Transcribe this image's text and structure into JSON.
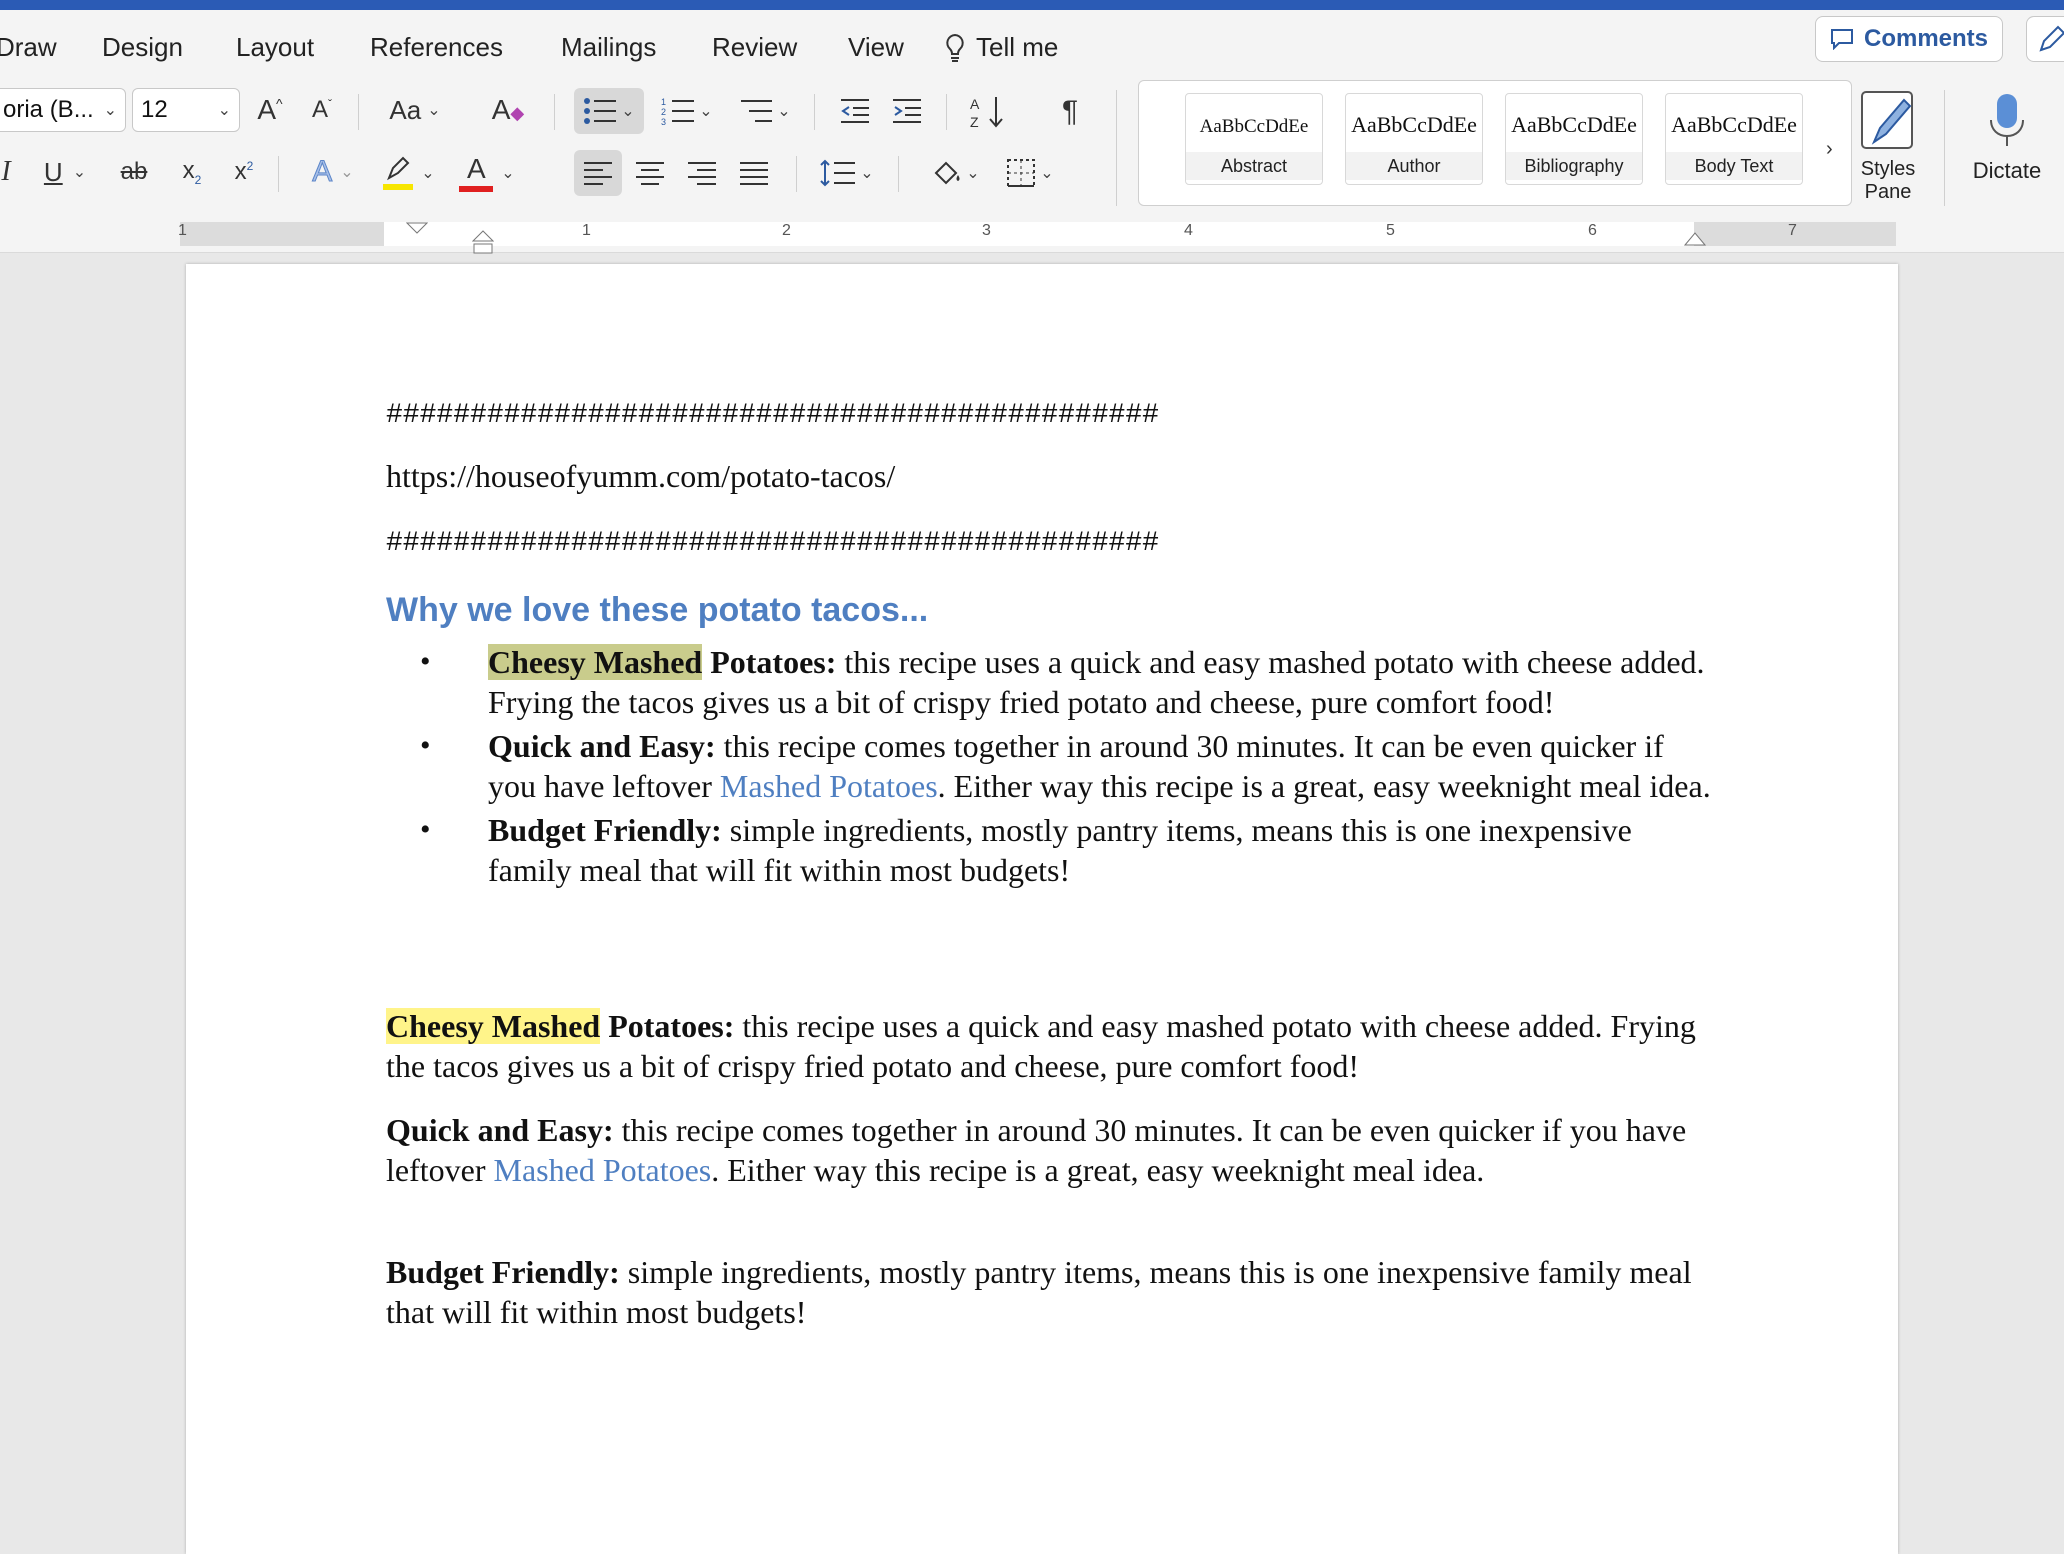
{
  "ribbon": {
    "tabs": [
      "Draw",
      "Design",
      "Layout",
      "References",
      "Mailings",
      "Review",
      "View"
    ],
    "tell_me": "Tell me",
    "comments_label": "Comments",
    "font_name": "oria (B...",
    "font_size": "12",
    "change_case": "Aa",
    "styles": [
      {
        "sample": "AaBbCcDdEe",
        "name": "Abstract"
      },
      {
        "sample": "AaBbCcDdEe",
        "name": "Author"
      },
      {
        "sample": "AaBbCcDdEe",
        "name": "Bibliography"
      },
      {
        "sample": "AaBbCcDdEe",
        "name": "Body Text"
      }
    ],
    "styles_pane_label_1": "Styles",
    "styles_pane_label_2": "Pane",
    "dictate_label": "Dictate",
    "highlight_color": "#f7e600",
    "font_color": "#e02020"
  },
  "ruler": {
    "numbers": [
      "1",
      "1",
      "2",
      "3",
      "4",
      "5",
      "6",
      "7"
    ]
  },
  "document": {
    "hash_line": "##############################################",
    "url": "https://houseofyumm.com/potato-tacos/",
    "heading": "Why we love these potato tacos...",
    "bullets": [
      {
        "hl": "Cheesy Mashed",
        "bold": " Potatoes:",
        "pre": " this recipe uses a quick and easy mashed potato with cheese added. Frying the tacos gives us a bit of crispy fried potato and cheese, pure comfort food!",
        "link": "",
        "post": ""
      },
      {
        "hl": "",
        "bold": "Quick and Easy:",
        "pre": " this recipe comes together in around 30 minutes. It can be even quicker if you have leftover ",
        "link": "Mashed Potatoes",
        "post": ". Either way this recipe is a great, easy weeknight meal idea."
      },
      {
        "hl": "",
        "bold": "Budget Friendly:",
        "pre": " simple ingredients, mostly pantry items, means this is one inexpensive family meal that will fit within most budgets!",
        "link": "",
        "post": ""
      }
    ],
    "paragraphs": [
      {
        "hl": "Cheesy Mashed",
        "bold": " Potatoes:",
        "pre": " this recipe uses a quick and easy mashed potato with cheese added. Frying the tacos gives us a bit of crispy fried potato and cheese, pure comfort food!",
        "link": "",
        "post": ""
      },
      {
        "hl": "",
        "bold": "Quick and Easy:",
        "pre": " this recipe comes together in around 30 minutes. It can be even quicker if you have leftover ",
        "link": "Mashed Potatoes",
        "post": ". Either way this recipe is a great, easy weeknight meal idea."
      },
      {
        "hl": "",
        "bold": "Budget Friendly:",
        "pre": " simple ingredients, mostly pantry items, means this is one inexpensive family meal that will fit within most budgets!",
        "link": "",
        "post": ""
      }
    ]
  }
}
